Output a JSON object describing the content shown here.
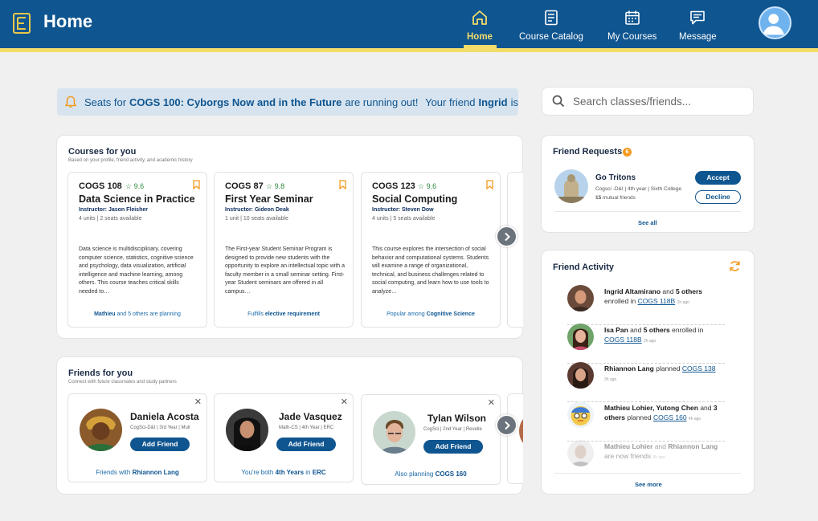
{
  "app": {
    "title": "Home"
  },
  "nav": [
    {
      "label": "Home",
      "icon": "home-icon",
      "active": true
    },
    {
      "label": "Course Catalog",
      "icon": "catalog-icon"
    },
    {
      "label": "My Courses",
      "icon": "calendar-icon"
    },
    {
      "label": "Message",
      "icon": "message-icon"
    }
  ],
  "colors": {
    "primary": "#0f5590",
    "accent": "#f2dd6a",
    "badge": "#f49a1e",
    "rating": "#2c8a3c"
  },
  "banner": {
    "pre": "Seats for ",
    "course": "COGS 100: Cyborgs Now and in the Future",
    "post": " are running out!",
    "friend_pre": "Your friend ",
    "friend": "Ingrid",
    "friend_post": " is"
  },
  "search": {
    "placeholder": "Search classes/friends..."
  },
  "courses": {
    "title": "Courses for you",
    "subtitle": "Based on your profile, friend activity, and academic history",
    "items": [
      {
        "code": "COGS 108",
        "rating": "9.6",
        "name": "Data Science in Practice",
        "instructor": "Instructor: Jason Fleisher",
        "units": "4 units | 2 seats available",
        "desc": "Data science is multidisciplinary, covering computer science, statistics, cognitive science and psychology, data visualization, artificial intelligence and machine learning, among others. This course teaches critical skills needed to…",
        "foot_bold": "Mathieu",
        "foot_rest": " and 5 others are planning"
      },
      {
        "code": "COGS 87",
        "rating": "9.8",
        "name": "First Year Seminar",
        "instructor": "Instructor: Gideon Deak",
        "units": "1 unit | 10 seats available",
        "desc": "The First-year Student Seminar Program is designed to provide new students with the opportunity to explore an intellectual topic with a faculty member in a small seminar setting. First-year Student seminars are offered in all campus…",
        "foot_pre": "Fulfills ",
        "foot_bold": "elective requirement"
      },
      {
        "code": "COGS 123",
        "rating": "9.6",
        "name": "Social Computing",
        "instructor": "Instructor: Steven Dow",
        "units": "4 units | 5 seats available",
        "desc": "This course explores the intersection of social behavior and computational systems. Students will examine a range of organizational, technical, and business challenges related to social computing, and learn how to use tools to analyze…",
        "foot_pre": "Popular among ",
        "foot_bold": "Cognitive Science"
      }
    ]
  },
  "friends": {
    "title": "Friends for you",
    "subtitle": "Connect with future classmates and study partners",
    "add_label": "Add Friend",
    "items": [
      {
        "name": "Daniela Acosta",
        "info": "CogSci-D&I | 3rd Year | Muir",
        "foot_pre": "Friends with ",
        "foot_bold": "Rhiannon Lang"
      },
      {
        "name": "Jade Vasquez",
        "info": "Math-CS | 4th Year | ERC",
        "foot_pre": "You're both ",
        "foot_bold": "4th Years",
        "foot_mid": " in ",
        "foot_bold2": "ERC"
      },
      {
        "name": "Tylan Wilson",
        "info": "CogSci | 2nd Year | Revelle",
        "foot_pre": "Also planning ",
        "foot_bold": "COGS 160"
      }
    ]
  },
  "requests": {
    "title": "Friend Requests",
    "count": "6",
    "name": "Go Tritons",
    "info": "Cogsci -D&I | 4th year | Sixth College",
    "mutual_count": "15",
    "mutual_text": " mutual friends",
    "accept": "Accept",
    "decline": "Decline",
    "see_all": "See all"
  },
  "activity": {
    "title": "Friend Activity",
    "see_more": "See more",
    "items": [
      {
        "a": "Ingrid Altamirano",
        "b": " and ",
        "c": "5 others",
        "d": " enrolled in ",
        "course": "COGS 118B",
        "ago": "1h ago"
      },
      {
        "a": "Isa Pan",
        "b": " and ",
        "c": "5 others",
        "d": " enrolled in ",
        "course": "COGS 118B",
        "ago": "2h ago"
      },
      {
        "a": "Rhiannon Lang",
        "b": " planned ",
        "c": "",
        "d": "",
        "course": "COGS 138",
        "ago": "3h ago"
      },
      {
        "a": "Mathieu Lohier, Yutong Chen",
        "b": " and ",
        "c": "3 others",
        "d": " planned ",
        "course": "COGS 160",
        "ago": "4h ago"
      },
      {
        "a": "Mathieu Lohier",
        "b": " and ",
        "c": "Rhiannon Lang",
        "d": " are now friends",
        "course": "",
        "ago": "5h ago"
      }
    ]
  }
}
